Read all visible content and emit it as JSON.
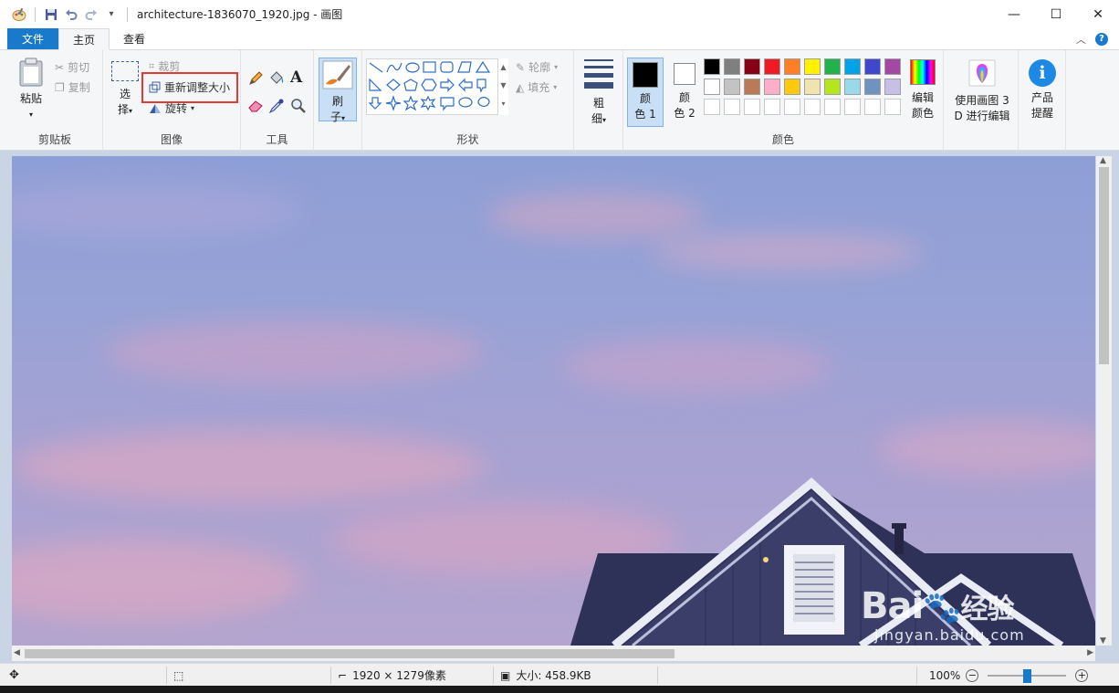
{
  "window": {
    "title": "architecture-1836070_1920.jpg - 画图",
    "minimize": "—",
    "maximize": "☐",
    "close": "✕"
  },
  "tabs": {
    "file": "文件",
    "home": "主页",
    "view": "查看",
    "collapse": "︿",
    "help": "?"
  },
  "clipboard": {
    "paste": "粘贴",
    "cut": "剪切",
    "copy": "复制",
    "label": "剪贴板"
  },
  "image": {
    "select_1": "选",
    "select_2": "择",
    "crop": "裁剪",
    "resize": "重新调整大小",
    "rotate": "旋转",
    "label": "图像"
  },
  "tools": {
    "label": "工具"
  },
  "brushes": {
    "line1": "刷",
    "line2": "子"
  },
  "shapes": {
    "outline": "轮廓",
    "fill": "填充",
    "label": "形状"
  },
  "size": {
    "line1": "粗",
    "line2": "细"
  },
  "colors": {
    "color1_a": "颜",
    "color1_b": "色 1",
    "color2_a": "颜",
    "color2_b": "色 2",
    "edit_a": "编辑",
    "edit_b": "颜色",
    "label": "颜色",
    "palette_row1": [
      "#000000",
      "#7f7f7f",
      "#880015",
      "#ed1c24",
      "#ff7f27",
      "#fff200",
      "#22b14c",
      "#00a2e8",
      "#3f48cc",
      "#a349a4"
    ],
    "palette_row2": [
      "#ffffff",
      "#c3c3c3",
      "#b97a57",
      "#ffaec9",
      "#ffc90e",
      "#efe4b0",
      "#b5e61d",
      "#99d9ea",
      "#7092be",
      "#c8bfe7"
    ]
  },
  "paint3d": {
    "line1": "使用画图 3",
    "line2": "D 进行编辑"
  },
  "product": {
    "line1": "产品",
    "line2": "提醒"
  },
  "status": {
    "dimensions": "1920 × 1279像素",
    "size": "大小: 458.9KB",
    "zoom": "100%",
    "zoom_level": 0.5
  },
  "watermark": {
    "brand": "Bai",
    "brand2": "经验",
    "url": "jingyan.baidu.com"
  }
}
